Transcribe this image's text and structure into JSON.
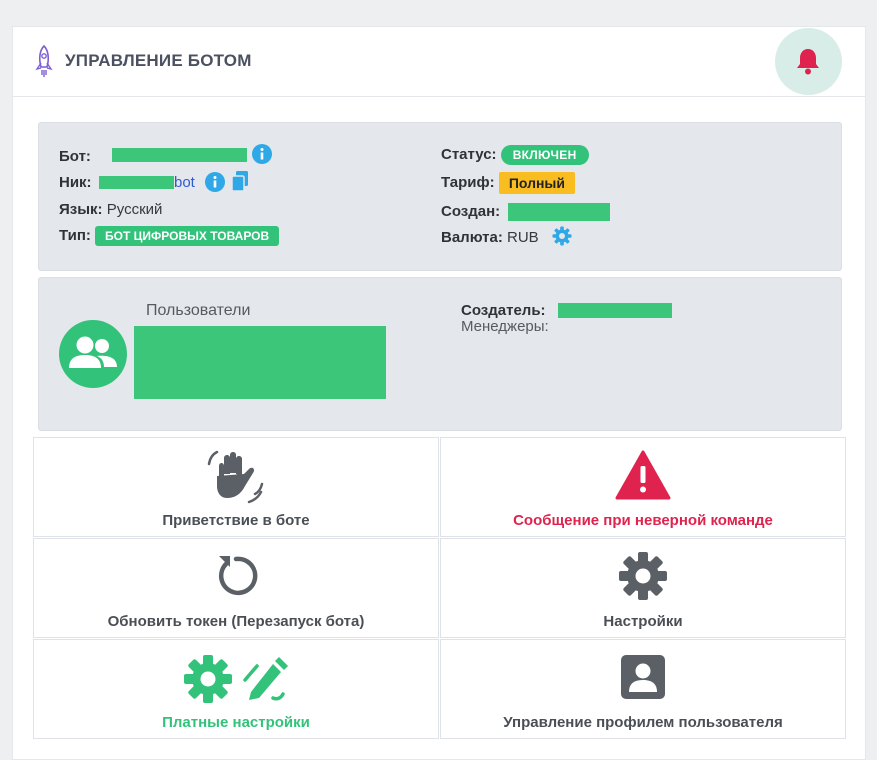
{
  "header": {
    "title": "УПРАВЛЕНИЕ БОТОМ",
    "rocket_icon": "rocket-icon",
    "bell_icon": "bell-icon",
    "accent_color": "#e0234e"
  },
  "info": {
    "bot_label": "Бот:",
    "nick_label": "Ник:",
    "nick_suffix": "bot",
    "lang_label": "Язык:",
    "lang_value": "Русский",
    "type_label": "Тип:",
    "type_value": "БОТ ЦИФРОВЫХ ТОВАРОВ",
    "status_label": "Статус:",
    "status_value": "ВКЛЮЧЕН",
    "tariff_label": "Тариф:",
    "tariff_value": "Полный",
    "created_label": "Создан:",
    "currency_label": "Валюта:",
    "currency_value": "RUB"
  },
  "users": {
    "title": "Пользователи",
    "creator_label": "Создатель:",
    "managers_label": "Менеджеры:"
  },
  "actions": [
    {
      "label": "Приветствие в боте",
      "icon": "waving-hand-icon",
      "color": "#4a4f55"
    },
    {
      "label": "Сообщение при неверной команде",
      "icon": "warning-icon",
      "color": "#e0234e"
    },
    {
      "label": "Обновить токен (Перезапуск бота)",
      "icon": "refresh-icon",
      "color": "#4a4f55"
    },
    {
      "label": "Настройки",
      "icon": "gear-icon",
      "color": "#4a4f55"
    },
    {
      "label": "Платные настройки",
      "icon": "gear-pen-icon",
      "color": "#33c27a"
    },
    {
      "label": "Управление профилем пользователя",
      "icon": "user-profile-icon",
      "color": "#4a4f55"
    }
  ],
  "colors": {
    "green": "#33c27a",
    "yellow": "#f9bd22",
    "red": "#e0234e",
    "info_blue": "#2fa8e8"
  }
}
